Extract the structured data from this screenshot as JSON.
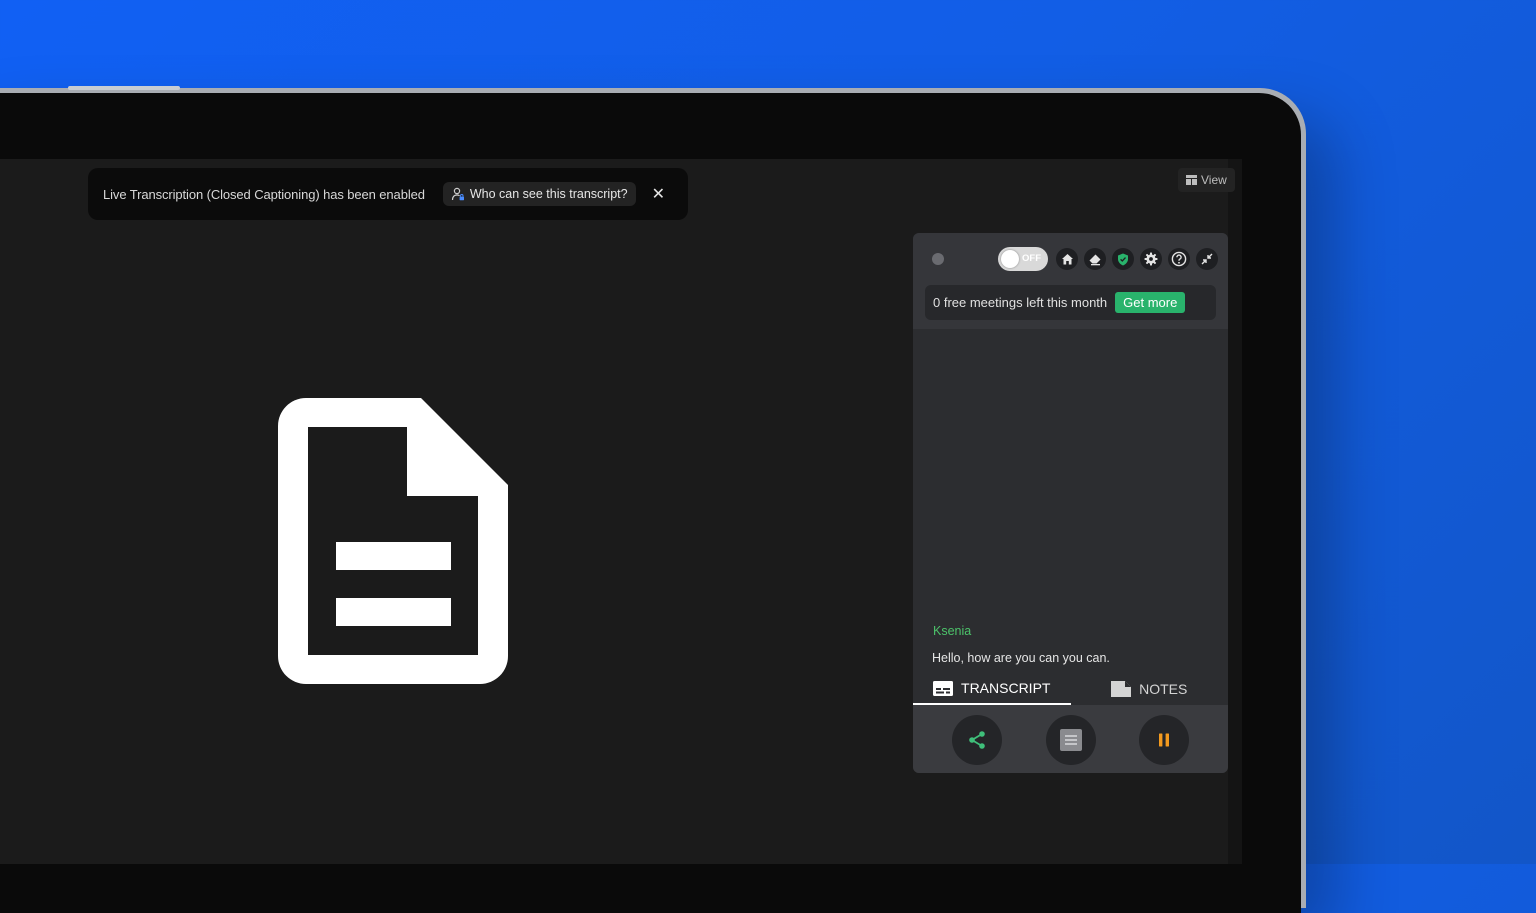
{
  "banner": {
    "message": "Live Transcription (Closed Captioning) has been enabled",
    "link_label": "Who can see this transcript?",
    "close_glyph": "✕",
    "link_icon": "user-lock-icon"
  },
  "view_button": {
    "label": "View",
    "icon": "grid-view-icon"
  },
  "panel": {
    "toggle_label": "OFF",
    "toggle_on": false,
    "toolbar_icons": [
      "home-icon",
      "eraser-icon",
      "shield-icon",
      "gear-icon",
      "help-icon",
      "collapse-icon"
    ],
    "quota_text": "0 free meetings left this month",
    "get_more_label": "Get more",
    "speaker": "Ksenia",
    "utterance": "Hello, how are you can you can.",
    "tabs": [
      {
        "label": "TRANSCRIPT",
        "icon": "captions-icon",
        "active": true
      },
      {
        "label": "NOTES",
        "icon": "note-icon",
        "active": false
      }
    ],
    "actions": [
      "share-icon",
      "document-icon",
      "pause-icon"
    ]
  },
  "colors": {
    "accent_green": "#29b36c",
    "speaker_green": "#4cc26a",
    "pause_orange": "#f39a1e",
    "background_blue": "#1160f4"
  }
}
